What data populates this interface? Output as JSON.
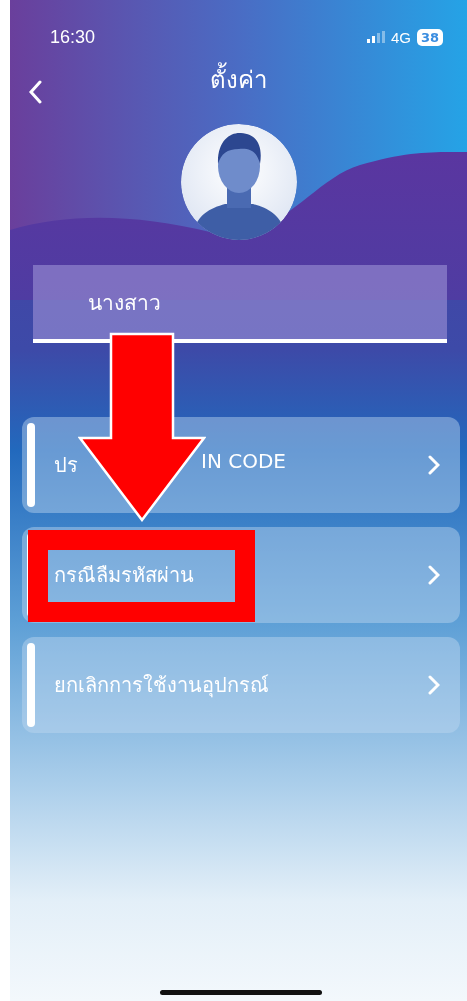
{
  "status_bar": {
    "time": "16:30",
    "network": "4G",
    "battery": "38"
  },
  "header": {
    "title": "ตั้งค่า"
  },
  "profile": {
    "name_field": {
      "value": "นางสาว"
    }
  },
  "menu": [
    {
      "label_parts": [
        "ปร",
        "IN CODE"
      ]
    },
    {
      "label_parts": [
        "กรณีลืมรหัสผ่าน"
      ]
    },
    {
      "label_parts": [
        "ยกเลิกการใช้งานอุปกรณ์"
      ]
    }
  ],
  "annotations": [
    {
      "kind": "arrow"
    },
    {
      "kind": "highlight-box"
    }
  ]
}
